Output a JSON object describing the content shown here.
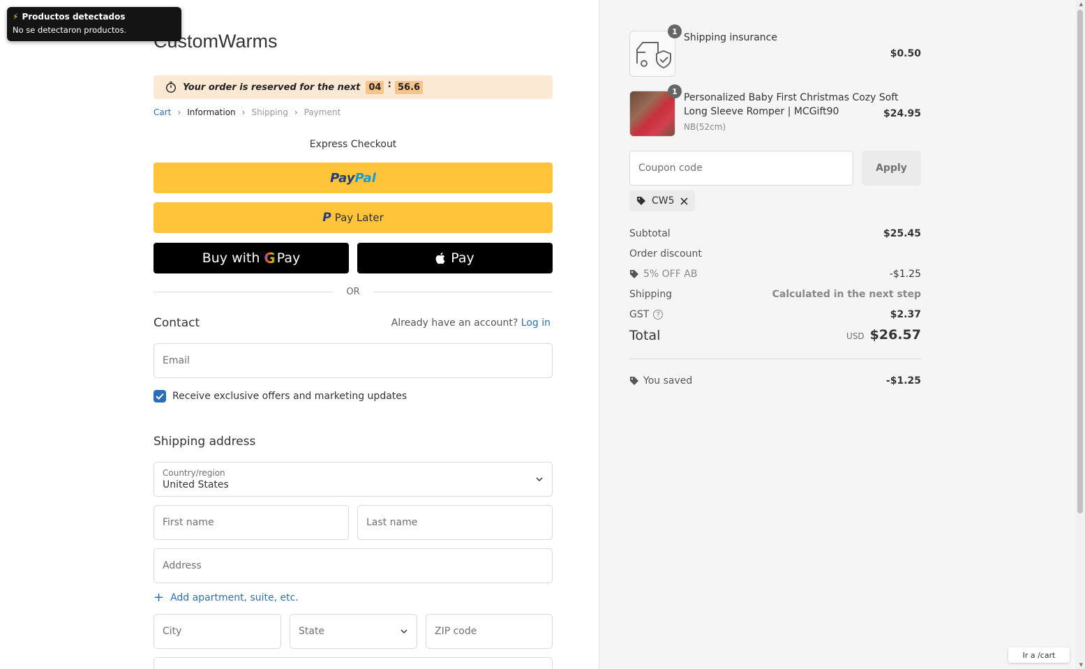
{
  "toast": {
    "title": "Productos detectados",
    "message": "No se detectaron productos."
  },
  "brand": "CustomWarms",
  "timer": {
    "message": "Your order is reserved for the next",
    "minutes": "04",
    "seconds": "56.6"
  },
  "breadcrumb": {
    "cart": "Cart",
    "information": "Information",
    "shipping": "Shipping",
    "payment": "Payment"
  },
  "express": {
    "title": "Express Checkout",
    "paypal_a": "Pay",
    "paypal_b": "Pal",
    "paylater_label": "Pay Later",
    "gpay_prefix": "Buy with",
    "gpay_g": "G",
    "gpay_suffix": "Pay",
    "applepay_label": "Pay",
    "or": "OR"
  },
  "contact": {
    "heading": "Contact",
    "account_prompt": "Already have an account?",
    "login_link": "Log in",
    "email_placeholder": "Email",
    "marketing_label": "Receive exclusive offers and marketing updates",
    "marketing_checked": true
  },
  "shipping_address": {
    "heading": "Shipping address",
    "country_label": "Country/region",
    "country_value": "United States",
    "first_name": "First name",
    "last_name": "Last name",
    "address": "Address",
    "add_apartment": "Add apartment, suite, etc.",
    "city": "City",
    "state": "State",
    "zip": "ZIP code"
  },
  "order": {
    "items": [
      {
        "name": "Shipping insurance",
        "variant": "",
        "quantity": "1",
        "price": "$0.50"
      },
      {
        "name_line1": "Personalized Baby First Christmas Cozy Soft",
        "name_line2": "Long Sleeve Romper | MCGift90",
        "variant": "NB(52cm)",
        "quantity": "1",
        "price": "$24.95"
      }
    ],
    "coupon_placeholder": "Coupon code",
    "apply_label": "Apply",
    "applied_code": "CW5",
    "summary": {
      "subtotal_label": "Subtotal",
      "subtotal": "$25.45",
      "order_discount_label": "Order discount",
      "discount_name": "5% OFF AB",
      "discount": "-$1.25",
      "shipping_label": "Shipping",
      "shipping": "Calculated in the next step",
      "gst_label": "GST",
      "gst": "$2.37",
      "total_label": "Total",
      "currency": "USD",
      "total": "$26.57",
      "saved_label": "You saved",
      "saved": "-$1.25"
    }
  },
  "floating_link": "Ir a /cart",
  "colors": {
    "accent": "#2a6fb5",
    "paypal_yellow": "#ffc439",
    "timer_bg": "#fbe9d4",
    "timer_box": "#f7c48b"
  }
}
